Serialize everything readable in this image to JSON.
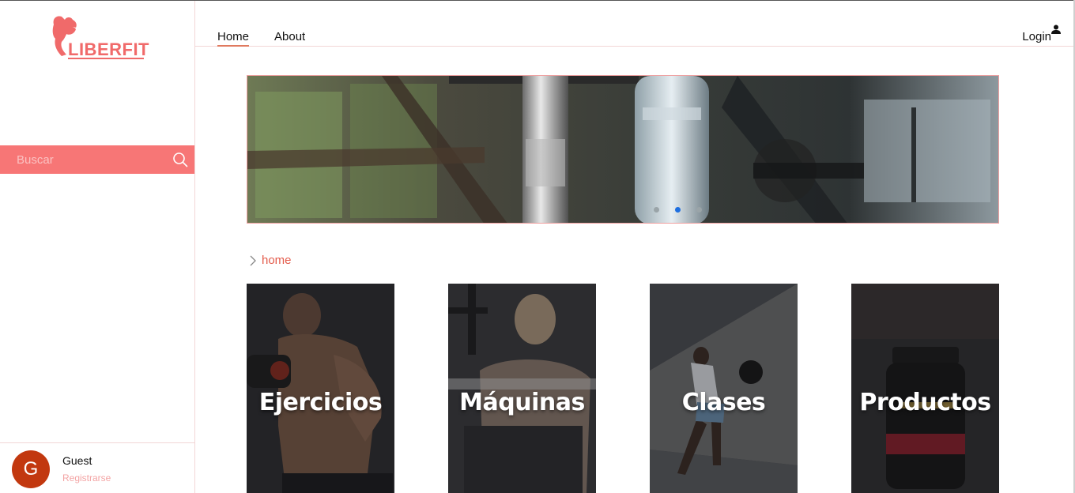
{
  "brand": {
    "name": "LIBERFIT",
    "color": "#f06a6a"
  },
  "search": {
    "placeholder": "Buscar",
    "icon": "search-icon"
  },
  "nav": {
    "items": [
      {
        "label": "Home",
        "active": true
      },
      {
        "label": "About",
        "active": false
      }
    ],
    "login_label": "Login",
    "login_icon": "person-icon"
  },
  "banner": {
    "dots": 3,
    "active_dot": 1
  },
  "breadcrumb": {
    "label": "home"
  },
  "cards": [
    {
      "title": "Ejercicios"
    },
    {
      "title": "Máquinas"
    },
    {
      "title": "Clases"
    },
    {
      "title": "Productos"
    }
  ],
  "user": {
    "initial": "G",
    "name": "Guest",
    "register_label": "Registrarse"
  },
  "colors": {
    "accent": "#f77676",
    "breadcrumb": "#e45c4c",
    "avatar": "#c2380f",
    "active_underline": "#e07a5f",
    "active_dot": "#1e6fe0"
  }
}
